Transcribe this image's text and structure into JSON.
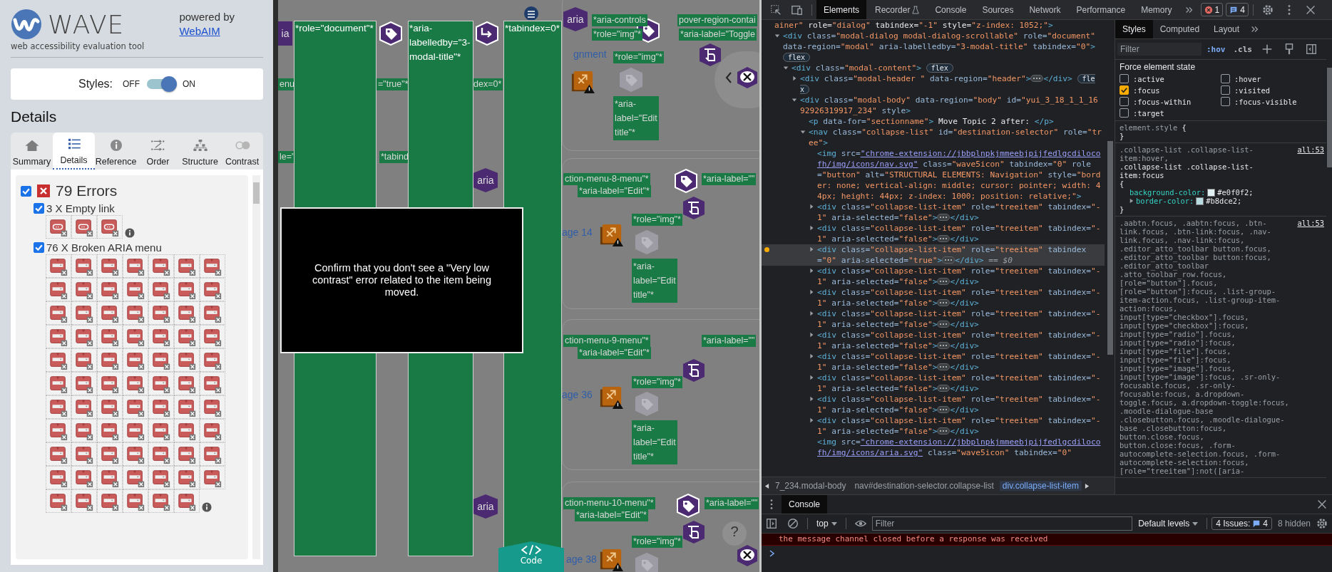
{
  "wave": {
    "logo": "WAVE",
    "tagline": "web accessibility evaluation tool",
    "powered_by": "powered by",
    "webaim_link": "WebAIM",
    "styles_toggle": {
      "label": "Styles:",
      "off": "OFF",
      "on_label": "ON",
      "on": true
    },
    "heading": "Details",
    "tabs": [
      {
        "label": "Summary",
        "selected": false
      },
      {
        "label": "Details",
        "selected": true
      },
      {
        "label": "Reference",
        "selected": false
      },
      {
        "label": "Order",
        "selected": false
      },
      {
        "label": "Structure",
        "selected": false
      },
      {
        "label": "Contrast",
        "selected": false
      }
    ],
    "errors": {
      "title": "79 Errors",
      "checked": true,
      "groups": [
        {
          "label": "3 X Empty link",
          "kind": "empty_link",
          "checked": true
        },
        {
          "label": "76 X Broken ARIA menu",
          "kind": "broken_aria",
          "checked": true
        }
      ]
    }
  },
  "page": {
    "columns": [
      {
        "text": "*role=\"document\"*"
      },
      {
        "text": "*aria-labelledby=\"3-modal-title\"*"
      },
      {
        "text": "*tabindex=0*"
      }
    ],
    "overlays": [
      {
        "kind": "tag",
        "text": "enu"
      },
      {
        "kind": "tag",
        "text": "=\"true\"*"
      },
      {
        "kind": "tag",
        "text": "dex=0*"
      },
      {
        "kind": "tag",
        "text": "le=\""
      },
      {
        "kind": "tag",
        "text": "*tabind"
      },
      {
        "kind": "tag",
        "text": "*aria-controls"
      },
      {
        "kind": "tag",
        "text": "pover-region-contai"
      },
      {
        "kind": "tag",
        "text": "*role=\"img\"*"
      },
      {
        "kind": "tag",
        "text": "*aria-label=\"Toggle"
      },
      {
        "kind": "link",
        "text": "gnment"
      },
      {
        "kind": "tag",
        "text": "*role=\"img\"*"
      },
      {
        "kind": "tag",
        "text": "*aria-label=\"Edit title\"*"
      },
      {
        "kind": "tag",
        "text": "ction-menu-8-menu\"*"
      },
      {
        "kind": "tag",
        "text": "*aria-label=\"Edit\"*"
      },
      {
        "kind": "tag",
        "text": "*aria-label=\"\""
      },
      {
        "kind": "tag",
        "text": "*role=\"img\"*"
      },
      {
        "kind": "link",
        "text": "age 14"
      },
      {
        "kind": "tag",
        "text": "*aria-label=\"Edit title\"*"
      },
      {
        "kind": "tag",
        "text": "ction-menu-9-menu\"*"
      },
      {
        "kind": "tag",
        "text": "*aria-label=\"Edit\"*"
      },
      {
        "kind": "tag",
        "text": "*aria-label=\"\""
      },
      {
        "kind": "tag",
        "text": "*role=\"img\"*"
      },
      {
        "kind": "link",
        "text": "age 36"
      },
      {
        "kind": "tag",
        "text": "*aria-label=\"Edit title\"*"
      },
      {
        "kind": "tag",
        "text": "ction-menu-10-menu\"*"
      },
      {
        "kind": "tag",
        "text": "*aria-label=\"Edit\"*"
      },
      {
        "kind": "tag",
        "text": "*aria-label=\"\""
      },
      {
        "kind": "tag",
        "text": "*role=\"img\"*"
      },
      {
        "kind": "link",
        "text": "age 38"
      },
      {
        "kind": "aria",
        "text": "ia"
      },
      {
        "kind": "aria",
        "text": "aria"
      },
      {
        "kind": "aria",
        "text": "aria"
      },
      {
        "kind": "aria",
        "text": "aria"
      }
    ],
    "modal": {
      "message": "Confirm that you don't see a \"Very low contrast\" error related to the item being moved."
    },
    "code_button": "Code",
    "help": "?"
  },
  "devtools": {
    "tabs": [
      {
        "label": "Elements",
        "selected": true
      },
      {
        "label": "Recorder",
        "selected": false
      },
      {
        "label": "Console",
        "selected": false
      },
      {
        "label": "Sources",
        "selected": false
      },
      {
        "label": "Network",
        "selected": false
      },
      {
        "label": "Performance",
        "selected": false
      },
      {
        "label": "Memory",
        "selected": false
      }
    ],
    "error_count": "1",
    "issue_count": "4",
    "tree": [
      {
        "lead": "ainer\"",
        "markup": " role=\"dialog\" tabindex=\"-1\" style=\"z-index: 1052;\">",
        "children": [
          {
            "markup": "<div class=\"modal-dialog modal-dialog-scrollable\" role=\"document\" data-region=\"modal\" aria-labelledby=\"3-modal-title\" tabindex=\"0\">",
            "badge": "flex",
            "expanded": true,
            "children": [
              {
                "markup": "<div class=\"modal-content\">",
                "badge": "flex",
                "expanded": true,
                "children": [
                  {
                    "markup": "<div class=\"modal-header \" data-region=\"header\">",
                    "ellipsis": true,
                    "close": "</div>",
                    "badge": "flex",
                    "expanded": false
                  },
                  {
                    "markup": "<div class=\"modal-body\" data-region=\"body\" id=\"yui_3_18_1_1_1692926319917_234\" style>",
                    "expanded": true,
                    "children": [
                      {
                        "markup": "<p data-for=\"sectionname\"> Move Topic 2 after: </p>"
                      },
                      {
                        "markup": "<nav class=\"collapse-list\" id=\"destination-selector\" role=\"tree\">",
                        "expanded": true,
                        "children": [
                          {
                            "markup": "<img src=\"chrome-extension://jbbplnpkjmmeebjpijfedlgcdilocofh/img/icons/nav.svg\" class=\"wave5icon\" tabindex=\"0\" role=\"button\" alt=\"STRUCTURAL ELEMENTS: Navigation\" style=\"border: none; vertical-align: middle; cursor: pointer; width: 44px; height: 44px; z-index: 1000; position: relative;\">",
                            "link": true
                          },
                          {
                            "markup": "<div class=\"collapse-list-item\" role=\"treeitem\" tabindex=\"-1\" aria-selected=\"false\">",
                            "ellipsis": true,
                            "close": "</div>",
                            "expanded": false,
                            "selected": false
                          },
                          {
                            "markup": "<div class=\"collapse-list-item\" role=\"treeitem\" tabindex=\"-1\" aria-selected=\"false\">",
                            "ellipsis": true,
                            "close": "</div>",
                            "expanded": false,
                            "selected": false
                          },
                          {
                            "markup": "<div class=\"collapse-list-item\" role=\"treeitem\" tabindex=\"0\" aria-selected=\"true\">",
                            "ellipsis": true,
                            "close": "</div>",
                            "expanded": false,
                            "selected": true,
                            "suffix": "== $0"
                          },
                          {
                            "markup": "<div class=\"collapse-list-item\" role=\"treeitem\" tabindex=\"-1\" aria-selected=\"false\">",
                            "ellipsis": true,
                            "close": "</div>",
                            "expanded": false,
                            "selected": false
                          },
                          {
                            "markup": "<div class=\"collapse-list-item\" role=\"treeitem\" tabindex=\"-1\" aria-selected=\"false\">",
                            "ellipsis": true,
                            "close": "</div>",
                            "expanded": false,
                            "selected": false
                          },
                          {
                            "markup": "<div class=\"collapse-list-item\" role=\"treeitem\" tabindex=\"-1\" aria-selected=\"false\">",
                            "ellipsis": true,
                            "close": "</div>",
                            "expanded": false,
                            "selected": false
                          },
                          {
                            "markup": "<div class=\"collapse-list-item\" role=\"treeitem\" tabindex=\"-1\" aria-selected=\"false\">",
                            "ellipsis": true,
                            "close": "</div>",
                            "expanded": false,
                            "selected": false
                          },
                          {
                            "markup": "<div class=\"collapse-list-item\" role=\"treeitem\" tabindex=\"-1\" aria-selected=\"false\">",
                            "ellipsis": true,
                            "close": "</div>",
                            "expanded": false,
                            "selected": false
                          },
                          {
                            "markup": "<div class=\"collapse-list-item\" role=\"treeitem\" tabindex=\"-1\" aria-selected=\"false\">",
                            "ellipsis": true,
                            "close": "</div>",
                            "expanded": false,
                            "selected": false
                          },
                          {
                            "markup": "<div class=\"collapse-list-item\" role=\"treeitem\" tabindex=\"-1\" aria-selected=\"false\">",
                            "ellipsis": true,
                            "close": "</div>",
                            "expanded": false,
                            "selected": false
                          },
                          {
                            "markup": "<div class=\"collapse-list-item\" role=\"treeitem\" tabindex=\"-1\" aria-selected=\"false\">",
                            "ellipsis": true,
                            "close": "</div>",
                            "expanded": false,
                            "selected": false
                          },
                          {
                            "markup": "<img src=\"chrome-extension://jbbplnpkjmmeebjpijfedlgcdilocofh/img/icons/aria.svg\" class=\"wave5icon\" tabindex=\"0\"",
                            "link": true
                          }
                        ]
                      }
                    ]
                  }
                ]
              }
            ]
          }
        ]
      }
    ],
    "breadcrumbs": [
      {
        "label": "7_234.modal-body",
        "selected": false
      },
      {
        "label": "nav#destination-selector.collapse-list",
        "selected": false
      },
      {
        "label": "div.collapse-list-item",
        "selected": true
      }
    ],
    "styles": {
      "tabs": [
        {
          "label": "Styles",
          "selected": true
        },
        {
          "label": "Computed",
          "selected": false
        },
        {
          "label": "Layout",
          "selected": false
        }
      ],
      "filter_placeholder": "Filter",
      "hov": ":hov",
      "cls": ".cls",
      "force_state_title": "Force element state",
      "states": [
        {
          "label": ":active",
          "checked": false
        },
        {
          "label": ":hover",
          "checked": false
        },
        {
          "label": ":focus",
          "checked": true
        },
        {
          "label": ":visited",
          "checked": false
        },
        {
          "label": ":focus-within",
          "checked": false
        },
        {
          "label": ":focus-visible",
          "checked": false
        },
        {
          "label": ":target",
          "checked": false
        }
      ],
      "element_style": {
        "selector": "element.style",
        "open": "{",
        "close": "}"
      },
      "rules": [
        {
          "source": "all:53",
          "selectors": [
            {
              "text": ".collapse-list .collapse-list-item:hover,",
              "matched": false
            },
            {
              "text": ".collapse-list .collapse-list-item:focus",
              "matched": true
            }
          ],
          "open": "{",
          "close": "}",
          "props": [
            {
              "name": "background-color:",
              "value": "#e0f0f2;",
              "expandable": false
            },
            {
              "name": "border-color:",
              "value": "#b8dce2;",
              "expandable": true
            }
          ]
        },
        {
          "source": "all:53",
          "selectors": [
            {
              "text": ".aabtn.focus, .aabtn:focus, .btn-link.focus, .btn-link:focus, .nav-link.focus, .nav-link:focus, .editor_atto_toolbar button.focus, .editor_atto_toolbar button:focus, .editor_atto_toolbar .atto_toolbar_row.focus, [role=\"button\"].focus, [role=\"button\"]:focus, .list-group-item-action.focus, .list-group-item-action:focus, input[type=\"checkbox\"].focus, input[type=\"checkbox\"]:focus, input[type=\"radio\"].focus, input[type=\"radio\"]:focus, input[type=\"file\"].focus, input[type=\"file\"]:focus, input[type=\"image\"].focus, input[type=\"image\"]:focus, .sr-only-focusable.focus, .sr-only-focusable:focus, a.dropdown-toggle.focus, a.dropdown-toggle:focus, .moodle-dialogue-base .closebutton.focus, .moodle-dialogue-base .closebutton:focus, button.close.focus, button.close:focus, .form-autocomplete-selection.focus, .form-autocomplete-selection:focus, [role=\"treeitem\"]:not([aria-",
              "matched": false
            }
          ]
        }
      ]
    },
    "console": {
      "tab": "Console",
      "context": "top",
      "filter_placeholder": "Filter",
      "levels": "Default levels",
      "issues_label": "4 Issues:",
      "issues_count": "4",
      "hidden": "8 hidden",
      "messages": [
        {
          "kind": "error",
          "text": "the message channel closed before a response was received"
        }
      ]
    }
  }
}
